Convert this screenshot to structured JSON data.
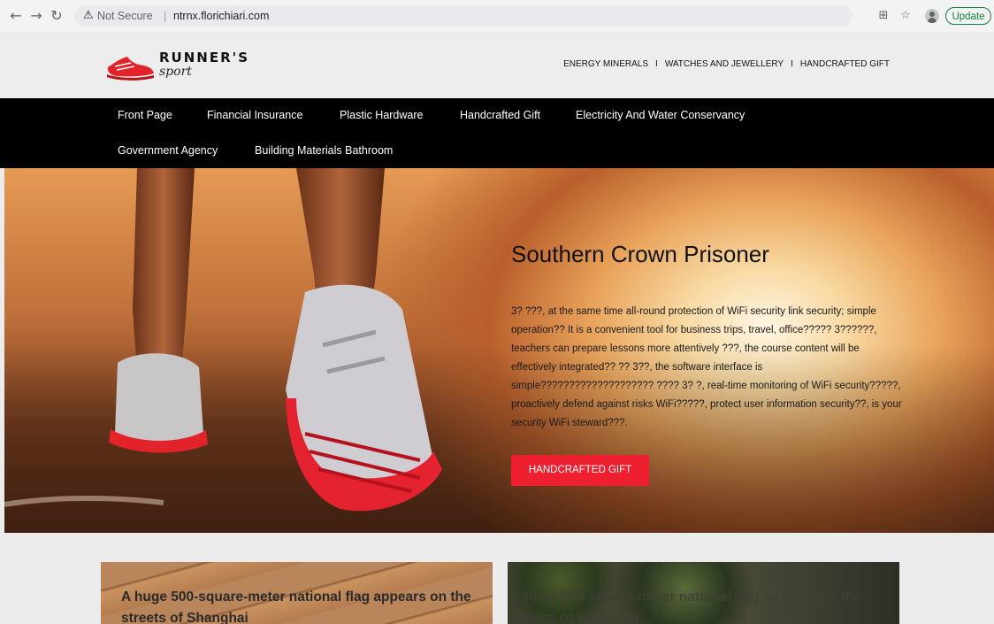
{
  "browser": {
    "security_label": "Not Secure",
    "separator": "|",
    "url": "ntrnx.florichiari.com",
    "update_label": "Update"
  },
  "site": {
    "logo": {
      "word": "RUNNER'S",
      "sub": "sport"
    },
    "top_links": [
      "ENERGY MINERALS",
      "WATCHES AND JEWELLERY",
      "HANDCRAFTED GIFT"
    ],
    "top_links_separator": "I",
    "nav": [
      "Front Page",
      "Financial Insurance",
      "Plastic Hardware",
      "Handcrafted Gift",
      "Electricity And Water Conservancy",
      "Government Agency",
      "Building Materials Bathroom"
    ]
  },
  "hero": {
    "title": "Southern Crown Prisoner",
    "text": "3? ???, at the same time all-round protection of WiFi security link security; simple operation?? It is a convenient tool for business trips, travel, office????? 3??????, teachers can prepare lessons more attentively ???, the course content will be effectively integrated?? ?? 3??, the software interface is simple???????????????????? ???? 3? ?, real-time monitoring of WiFi security?????, proactively defend against risks WiFi?????, protect user information security??, is your security WiFi steward???.",
    "button_label": "HANDCRAFTED GIFT"
  },
  "articles": [
    {
      "title": "A huge 500-square-meter national flag appears on the streets of Shanghai"
    },
    {
      "title": "A huge 500-square-meter national flag appears on the streets of Shanghai"
    }
  ],
  "colors": {
    "accent": "#ee1f2f",
    "nav_bg": "#000000",
    "header_bg": "#ededed"
  }
}
